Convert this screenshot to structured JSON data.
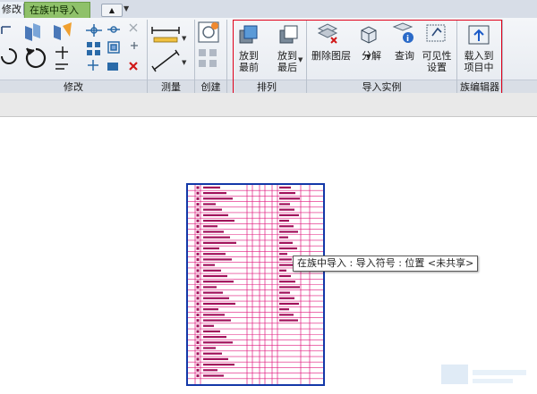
{
  "tabs": {
    "modify": "修改",
    "active": "在族中导入"
  },
  "quick_access": {
    "icon": "ribbon-toggle-icon"
  },
  "panels": {
    "modify": "修改",
    "measure": "测量",
    "create": "创建",
    "arrange": "排列",
    "import_instance": "导入实例",
    "family_editor": "族编辑器"
  },
  "buttons": {
    "bring_front_1": "放到",
    "bring_front_2": "最前",
    "send_back_1": "放到",
    "send_back_2": "最后",
    "delete_layers": "删除图层",
    "explode": "分解",
    "query": "查询",
    "visibility_1": "可见性",
    "visibility_2": "设置",
    "load_1": "载入到",
    "load_2": "项目中"
  },
  "tooltip": "在族中导入 : 导入符号 : 位置 <未共享>",
  "colors": {
    "accent_tab": "#8fc16a",
    "highlight": "#e0001a",
    "drawing_border": "#1338a8",
    "drawing_lines": "#e0197e"
  }
}
